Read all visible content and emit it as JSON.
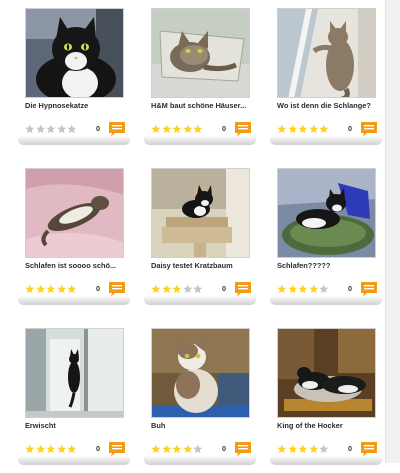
{
  "colors": {
    "star_filled": "#ffd21f",
    "star_empty": "#c4c4c4",
    "comment_icon": "#f59a14"
  },
  "gallery": {
    "items": [
      {
        "caption": "Die Hypnosekatze",
        "rating": 0,
        "comments": "0"
      },
      {
        "caption": "H&M baut schöne Häuser...",
        "rating": 5,
        "comments": "0"
      },
      {
        "caption": "Wo ist denn die Schlange?",
        "rating": 5,
        "comments": "0"
      },
      {
        "caption": "Schlafen ist soooo schö...",
        "rating": 5,
        "comments": "0"
      },
      {
        "caption": "Daisy testet Kratzbaum",
        "rating": 3,
        "comments": "0"
      },
      {
        "caption": "Schlafen?????",
        "rating": 4,
        "comments": "0"
      },
      {
        "caption": "Erwischt",
        "rating": 5,
        "comments": "0"
      },
      {
        "caption": "Buh",
        "rating": 4,
        "comments": "0"
      },
      {
        "caption": "King of the Hocker",
        "rating": 4,
        "comments": "0"
      }
    ]
  }
}
